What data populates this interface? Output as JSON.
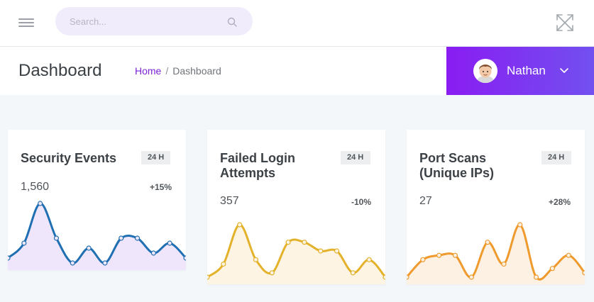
{
  "topbar": {
    "menu_icon": "hamburger-menu-icon",
    "search": {
      "placeholder": "Search...",
      "icon": "search-icon"
    },
    "fullscreen_icon": "fullscreen-icon"
  },
  "header": {
    "title": "Dashboard",
    "breadcrumb": {
      "home": "Home",
      "separator": "/",
      "current": "Dashboard"
    }
  },
  "user": {
    "name": "Nathan",
    "avatar_icon": "avatar-icon",
    "dropdown_icon": "chevron-down-icon",
    "gradient": [
      "#8a1cf2",
      "#7250f0"
    ]
  },
  "cards": [
    {
      "title": "Security Events",
      "badge": "24 H",
      "value": "1,560",
      "delta": "+15%",
      "line_color": "#1f6fb2",
      "fill_color": "#efe6fb",
      "series": [
        4,
        7,
        15,
        8,
        3,
        6,
        3,
        8,
        8,
        5,
        7,
        4
      ]
    },
    {
      "title": "Failed Login Attempts",
      "badge": "24 H",
      "value": "357",
      "delta": "-10%",
      "line_color": "#e3b12a",
      "fill_color": "#fdf4e3",
      "series": [
        2,
        5,
        14,
        6,
        3,
        10,
        10,
        8,
        8,
        3,
        6,
        2
      ]
    },
    {
      "title": "Port Scans (Unique IPs)",
      "badge": "24 H",
      "value": "27",
      "delta": "+28%",
      "line_color": "#ef9a2c",
      "fill_color": "#fdf1e4",
      "series": [
        2,
        6,
        7,
        7,
        2,
        10,
        5,
        14,
        2,
        4,
        7,
        3
      ]
    }
  ]
}
